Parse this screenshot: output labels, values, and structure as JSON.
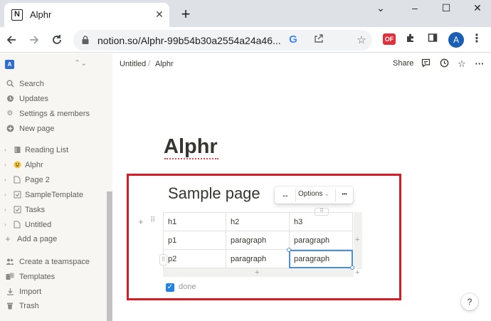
{
  "browser": {
    "tab": {
      "favicon": "N",
      "title": "Alphr",
      "close": "✕"
    },
    "new_tab": "+",
    "window_controls": {
      "minimize": "⌄",
      "restore": "–",
      "maximize": "☐",
      "close": "✕"
    },
    "omnibox": {
      "url": "notion.so/Alphr-99b54b30a2554a24a46..."
    },
    "extensions": {
      "of_label": "OF"
    },
    "profile_initial": "A"
  },
  "sidebar": {
    "workspace_initial": "A",
    "top_items": [
      {
        "label": "Search",
        "icon": "search-icon"
      },
      {
        "label": "Updates",
        "icon": "clock-icon"
      },
      {
        "label": "Settings & members",
        "icon": "gear-icon"
      },
      {
        "label": "New page",
        "icon": "plus-circle-icon"
      }
    ],
    "pages": [
      {
        "label": "Reading List",
        "icon": "book-icon"
      },
      {
        "label": "Alphr",
        "icon": "smiley-icon"
      },
      {
        "label": "Page 2",
        "icon": "page-icon"
      },
      {
        "label": "SampleTemplate",
        "icon": "checkbox-page-icon"
      },
      {
        "label": "Tasks",
        "icon": "checkbox-page-icon"
      },
      {
        "label": "Untitled",
        "icon": "page-icon"
      }
    ],
    "add_page": "Add a page",
    "bottom_items": [
      {
        "label": "Create a teamspace",
        "icon": "team-icon"
      },
      {
        "label": "Templates",
        "icon": "templates-icon"
      },
      {
        "label": "Import",
        "icon": "import-icon"
      },
      {
        "label": "Trash",
        "icon": "trash-icon"
      }
    ]
  },
  "topbar": {
    "breadcrumb": [
      "Untitled",
      "Alphr"
    ],
    "breadcrumb_sep": "/",
    "share": "Share"
  },
  "page": {
    "title": "Alphr",
    "subpage_title": "Sample page",
    "table_toolbar": {
      "arrows": "↔",
      "options": "Options",
      "dots": "•••"
    },
    "table": [
      [
        "h1",
        "h2",
        "h3"
      ],
      [
        "p1",
        "paragraph",
        "paragraph"
      ],
      [
        "p2",
        "paragraph",
        "paragraph"
      ]
    ],
    "todo": {
      "label": "done",
      "checked": true
    },
    "help": "?"
  },
  "colors": {
    "highlight_box": "#d51d28",
    "checkbox": "#2383e2",
    "selection": "#4a90d9"
  }
}
